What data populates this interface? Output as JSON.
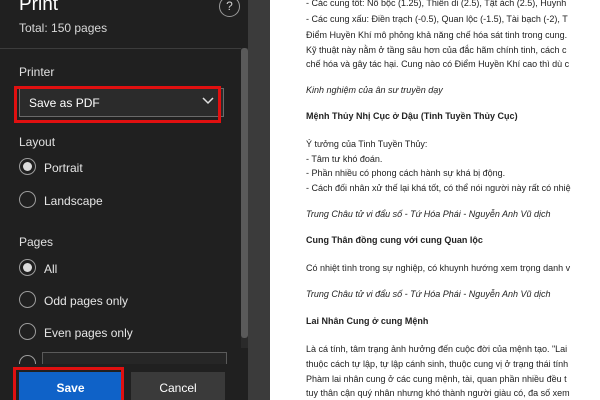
{
  "panel": {
    "title": "Print",
    "total": "Total: 150 pages",
    "help_label": "?",
    "printer": {
      "label": "Printer",
      "value": "Save as PDF"
    },
    "layout": {
      "label": "Layout",
      "options": [
        "Portrait",
        "Landscape"
      ],
      "selected": "Portrait"
    },
    "pages": {
      "label": "Pages",
      "options": [
        "All",
        "Odd pages only",
        "Even pages only"
      ],
      "selected": "All"
    },
    "buttons": {
      "save": "Save",
      "cancel": "Cancel"
    }
  },
  "accent": {
    "save_blue": "#0f62c8",
    "highlight_red": "#e01010"
  },
  "document": {
    "lines": [
      "- Các cung tốt: Nô bộc (1.25), Thiên di (2.5), Tật ách (2.5), Huynh",
      "- Các cung xấu: Điền trạch (-0.5), Quan lộc (-1.5), Tài bạch (-2), T",
      "Điểm Huyền Khí mô phỏng khả năng chế hóa sát tinh trong cung.",
      "Kỹ thuật này nằm ở tầng sâu hơn của đắc hãm chính tinh, cách c",
      "chế hóa và gây tác hại. Cung nào có Điểm Huyền Khí cao thì dù c",
      "Kinh nghiệm của ân sư truyền dạy",
      "Mệnh Thủy Nhị Cục ở Dậu (Tinh Tuyền Thủy Cục)",
      "Ý tưởng của Tinh Tuyền Thủy:",
      "- Tâm tư khó đoán.",
      "- Phần nhiều có phong cách hành sự khá bị động.",
      "- Cách đối nhân xử thế lại khá tốt, có thể nói người này rất có nhiệ",
      "Trung Châu tử vi đẩu số - Tứ Hóa Phái - Nguyễn Anh Vũ dịch",
      "Cung Thân đồng cung với cung Quan lộc",
      "Có nhiệt tình trong sự nghiệp, có khuynh hướng xem trọng danh v",
      "Trung Châu tử vi đẩu số - Tứ Hóa Phái - Nguyễn Anh Vũ dịch",
      "Lai Nhân Cung ở cung Mệnh",
      "Là cá tính, tâm trạng ảnh hưởng đến cuộc đời của mệnh tạo. \"Lai",
      "thuộc cách tự lập, tự lập cánh sinh, thuộc cung vị ở trạng thái tính",
      "Phàm lai nhân cung ở các cung mệnh, tài, quan phần nhiều đều t",
      "tuy thân cận quý nhân nhưng khó thành người giàu có, đa số xem"
    ]
  }
}
